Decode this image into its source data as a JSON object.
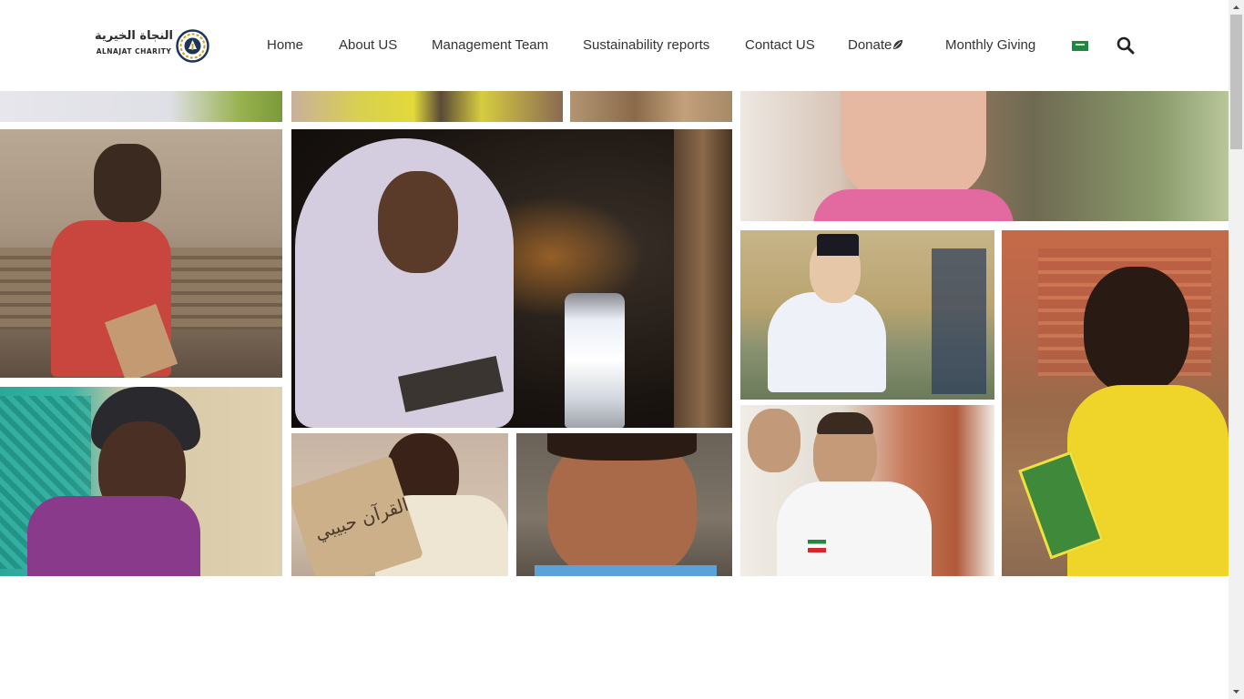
{
  "brand": {
    "arabic_name": "النجاة الخيرية",
    "english_name": "ALNAJAT CHARITY",
    "emblem_icon": "alnajat-emblem-icon"
  },
  "nav": {
    "items": [
      {
        "label": "Home"
      },
      {
        "label": "About US"
      },
      {
        "label": "Management Team"
      },
      {
        "label": "Sustainability reports"
      },
      {
        "label": "Contact US"
      },
      {
        "label": "Donate",
        "icon": "leaf-icon"
      },
      {
        "label": "Monthly Giving"
      }
    ],
    "language_flag": "saudi-flag-icon",
    "search_icon": "search-icon"
  },
  "gallery": {
    "photos": [
      {
        "name": "photo-man-woodworking"
      },
      {
        "name": "photo-girl-hijab-lantern"
      },
      {
        "name": "photo-little-girl-smiling"
      },
      {
        "name": "photo-boy-reading-book"
      },
      {
        "name": "photo-boy-yellow-shirt"
      },
      {
        "name": "photo-girl-headscarf"
      },
      {
        "name": "photo-boy-wooden-tablet"
      },
      {
        "name": "photo-boy-portrait"
      },
      {
        "name": "photo-boy-white-shirt"
      }
    ],
    "tablet_text": "القرآن حبيبي"
  },
  "colors": {
    "nav_text": "#333333",
    "brand_navy": "#1d3557",
    "brand_gold": "#c9a227",
    "flag_green": "#1c8a3e"
  }
}
